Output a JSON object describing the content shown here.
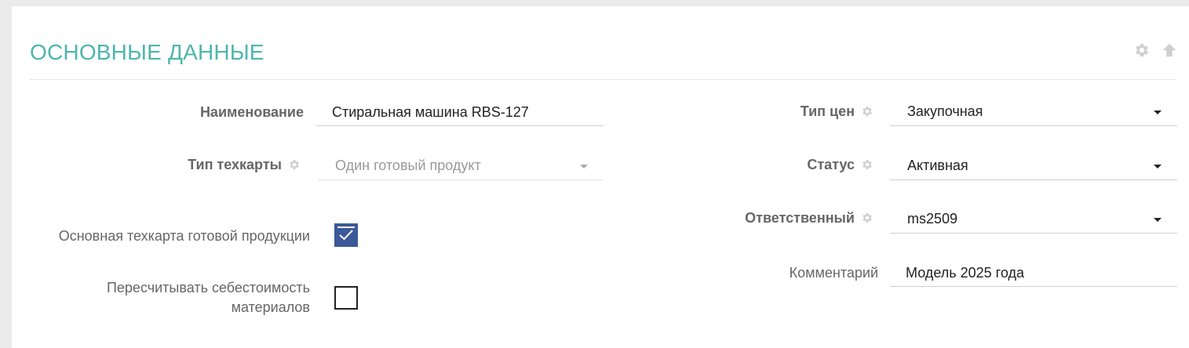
{
  "panel": {
    "title": "ОСНОВНЫЕ ДАННЫЕ",
    "accent_color": "#4db6ac",
    "tools": [
      {
        "icon": "gear-icon"
      },
      {
        "icon": "arrow-up-icon"
      }
    ]
  },
  "left": {
    "name": {
      "label": "Наименование",
      "value": "Стиральная машина RBS-127"
    },
    "techcard_type": {
      "label": "Тип техкарты",
      "selected": "Один готовый продукт",
      "disabled": true
    },
    "main_techcard": {
      "label": "Основная техкарта готовой продукции",
      "checked": true
    },
    "recalc_cost": {
      "label": "Пересчитывать себестоимость материалов",
      "checked": false
    }
  },
  "right": {
    "price_type": {
      "label": "Тип цен",
      "selected": "Закупочная"
    },
    "status": {
      "label": "Статус",
      "selected": "Активная"
    },
    "responsible": {
      "label": "Ответственный",
      "selected": "ms2509"
    },
    "comment": {
      "label": "Комментарий",
      "value": "Модель 2025 года"
    }
  },
  "colors": {
    "checkbox_checked": "#3b5998",
    "label_text": "#666666"
  }
}
